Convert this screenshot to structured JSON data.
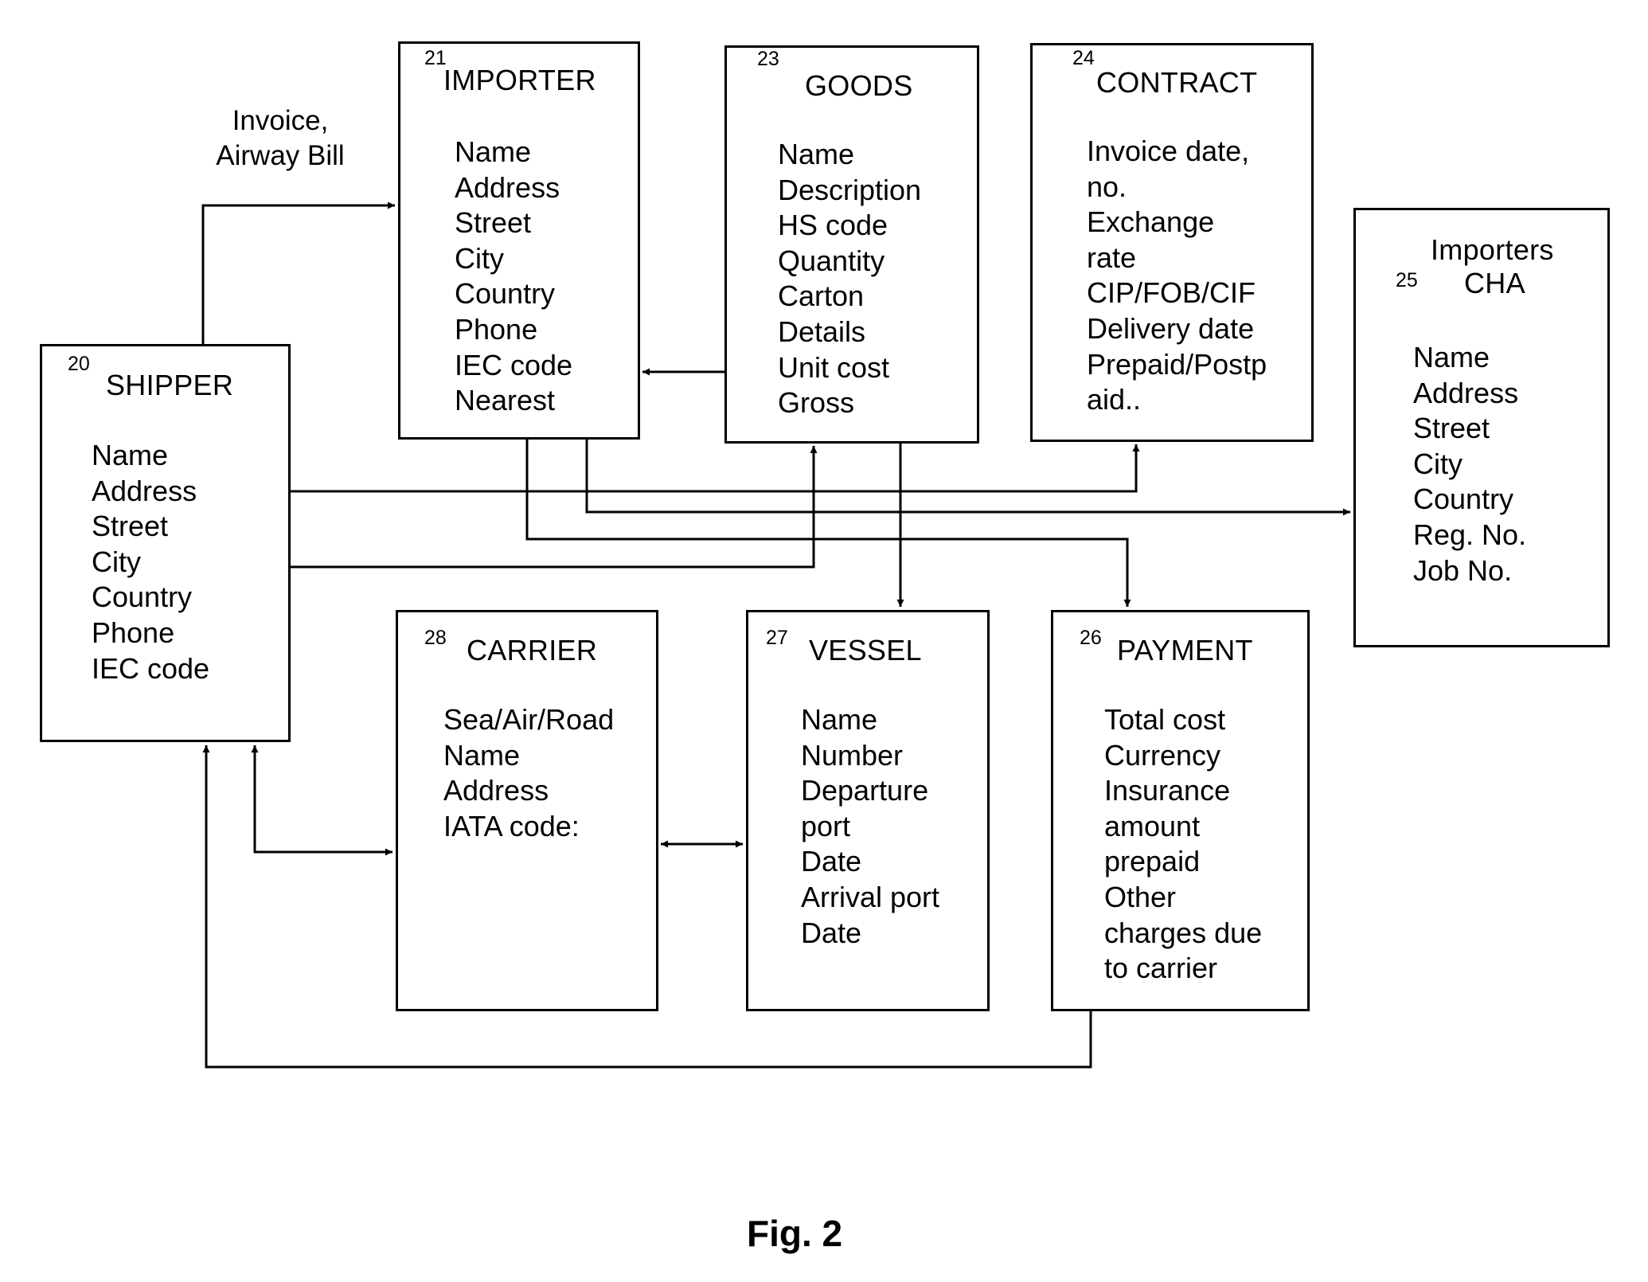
{
  "entities": {
    "shipper": {
      "number": "20",
      "title": "SHIPPER",
      "fields": [
        "Name",
        "Address",
        "Street",
        "City",
        "Country",
        "Phone",
        "IEC code"
      ]
    },
    "importer": {
      "number": "21",
      "title": "IMPORTER",
      "fields": [
        "Name",
        "Address",
        "Street",
        "City",
        "Country",
        "Phone",
        "IEC code",
        "Nearest"
      ]
    },
    "goods": {
      "number": "23",
      "title": "GOODS",
      "fields": [
        "Name",
        "Description",
        "HS code",
        "Quantity",
        "Carton",
        "Details",
        "Unit cost",
        "Gross"
      ]
    },
    "contract": {
      "number": "24",
      "title": "CONTRACT",
      "fields": [
        "Invoice date,",
        "no.",
        "Exchange",
        "rate",
        "CIP/FOB/CIF",
        "Delivery date",
        "Prepaid/Postp",
        "aid.."
      ]
    },
    "cha": {
      "number": "25",
      "title_line1": "Importers",
      "title_line2": "CHA",
      "fields": [
        "Name",
        "Address",
        "Street",
        "City",
        "Country",
        "Reg. No.",
        "Job No."
      ]
    },
    "payment": {
      "number": "26",
      "title": "PAYMENT",
      "fields": [
        "Total cost",
        "Currency",
        "Insurance",
        "amount",
        "prepaid",
        "Other",
        "charges due",
        "to carrier"
      ]
    },
    "vessel": {
      "number": "27",
      "title": "VESSEL",
      "fields": [
        "Name",
        "Number",
        "Departure",
        "port",
        "Date",
        "Arrival port",
        "Date"
      ]
    },
    "carrier": {
      "number": "28",
      "title": "CARRIER",
      "fields": [
        "Sea/Air/Road",
        "Name",
        "Address",
        "IATA code:"
      ]
    }
  },
  "connections": [
    {
      "from": "shipper",
      "to": "importer",
      "label": "Invoice,\nAirway Bill",
      "direction": "forward"
    },
    {
      "from": "goods",
      "to": "importer",
      "direction": "forward"
    },
    {
      "from": "shipper",
      "to": "contract",
      "direction": "forward"
    },
    {
      "from": "importer",
      "to": "cha",
      "direction": "forward"
    },
    {
      "from": "importer",
      "to": "payment",
      "direction": "forward"
    },
    {
      "from": "shipper",
      "to": "goods",
      "direction": "forward"
    },
    {
      "from": "goods",
      "to": "vessel",
      "direction": "forward"
    },
    {
      "from": "shipper",
      "to": "carrier",
      "direction": "both"
    },
    {
      "from": "carrier",
      "to": "vessel",
      "direction": "both"
    },
    {
      "from": "payment",
      "to": "shipper",
      "direction": "forward"
    }
  ],
  "labels": {
    "invoice_line1": "Invoice,",
    "invoice_line2": "Airway Bill"
  },
  "caption": "Fig. 2"
}
